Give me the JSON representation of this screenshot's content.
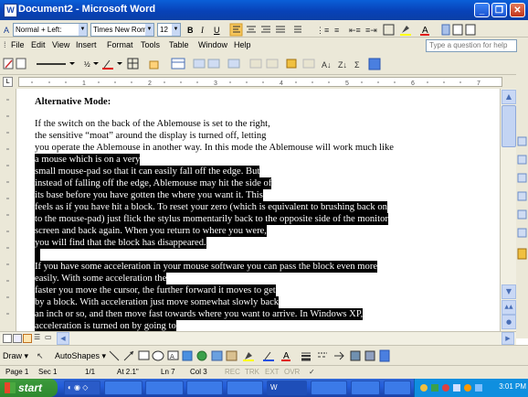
{
  "window": {
    "title": "Document2 - Microsoft Word"
  },
  "format_bar": {
    "style": "Normal + Left:",
    "font": "Times New Roman",
    "size": "12"
  },
  "menu": {
    "items": [
      "File",
      "Edit",
      "View",
      "Insert",
      "Format",
      "Tools",
      "Table",
      "Window",
      "Help"
    ],
    "help_placeholder": "Type a question for help"
  },
  "document": {
    "heading": "Alternative Mode:",
    "lines": [
      "If the switch on the back of the Ablemouse is set to the right,",
      "the sensitive “moat” around the display is turned off, letting",
      "you operate the Ablemouse in another way. In this mode the Ablemouse will work much like",
      "a mouse which is on a very",
      "small mouse-pad so that it can easily fall off the edge. But",
      "instead of falling off the edge, Ablemouse may hit the side of",
      "its base before you have gotten the where you want it. This",
      "feels as if you have hit a block. To reset your zero (which is equivalent to brushing back on",
      "to the mouse-pad) just flick the stylus momentarily back to the opposite side of the monitor",
      "screen and back again. When you return to where you were,",
      "you will find that the block has disappeared.",
      "",
      "If you have some acceleration in your mouse software you can pass the block even more",
      "easily. With some acceleration the",
      "faster you move the cursor, the further forward it moves to get",
      "by a block. With acceleration just move somewhat slowly back",
      "an inch or so, and then move fast towards where you want to arrive.  In Windows XP,",
      "acceleration is turned on by going to"
    ]
  },
  "drawing_bar": {
    "draw": "Draw",
    "autoshapes": "AutoShapes"
  },
  "status": {
    "page": "Page 1",
    "sec": "Sec 1",
    "pages": "1/1",
    "at": "At 2.1\"",
    "ln": "Ln 7",
    "col": "Col 3",
    "rec": "REC",
    "trk": "TRK",
    "ext": "EXT",
    "ovr": "OVR"
  },
  "taskbar": {
    "start": "start",
    "items": [
      "",
      "",
      "",
      "",
      "W",
      "",
      "",
      ""
    ],
    "clock": "3:01 PM"
  }
}
